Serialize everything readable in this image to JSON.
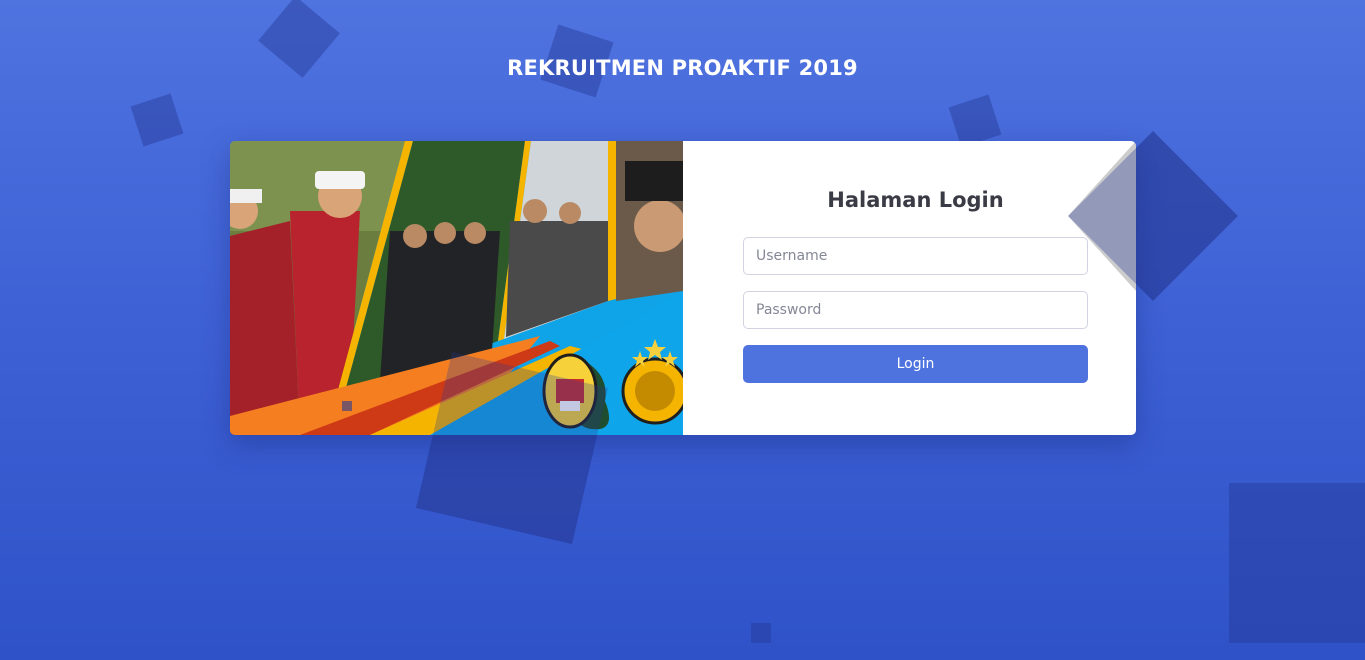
{
  "header": {
    "title": "REKRUITMEN PROAKTIF 2019"
  },
  "login": {
    "title": "Halaman Login",
    "username": {
      "placeholder": "Username",
      "value": ""
    },
    "password": {
      "placeholder": "Password",
      "value": ""
    },
    "submit_label": "Login"
  },
  "colors": {
    "background": "#4e73df",
    "button": "#4e73df",
    "card": "#ffffff"
  },
  "banner": {
    "image_description_icon": "police-recruitment-banner-image"
  }
}
